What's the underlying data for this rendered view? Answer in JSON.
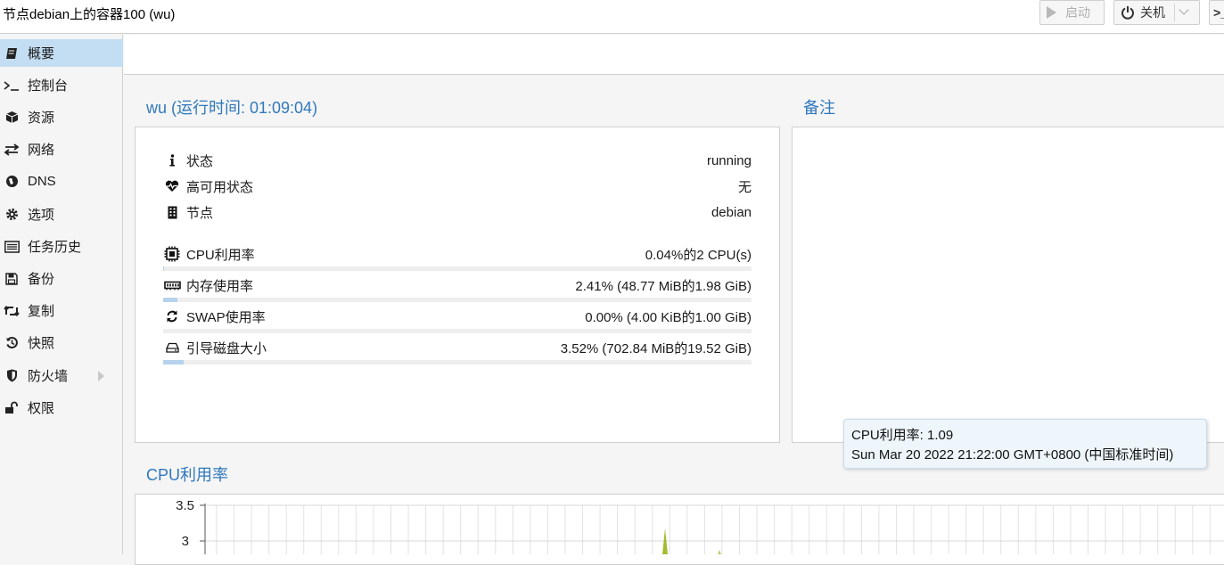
{
  "window": {
    "title": "节点debian上的容器100 (wu)",
    "buttons": {
      "start": "启动",
      "shutdown": "关机",
      "console": ">_"
    }
  },
  "sidebar": {
    "items": [
      {
        "label": "概要",
        "icon": "book-icon",
        "active": true
      },
      {
        "label": "控制台",
        "icon": "terminal-icon"
      },
      {
        "label": "资源",
        "icon": "cube-icon"
      },
      {
        "label": "网络",
        "icon": "exchange-icon"
      },
      {
        "label": "DNS",
        "icon": "globe-icon"
      },
      {
        "label": "选项",
        "icon": "gear-icon"
      },
      {
        "label": "任务历史",
        "icon": "list-icon"
      },
      {
        "label": "备份",
        "icon": "floppy-icon"
      },
      {
        "label": "复制",
        "icon": "retweet-icon"
      },
      {
        "label": "快照",
        "icon": "history-icon"
      },
      {
        "label": "防火墙",
        "icon": "shield-icon",
        "has_submenu": true
      },
      {
        "label": "权限",
        "icon": "unlock-icon"
      }
    ]
  },
  "status_panel": {
    "title": "wu (运行时间: 01:09:04)",
    "rows": [
      {
        "label": "状态",
        "value": "running",
        "icon": "info-icon"
      },
      {
        "label": "高可用状态",
        "value": "无",
        "icon": "heartbeat-icon"
      },
      {
        "label": "节点",
        "value": "debian",
        "icon": "building-icon"
      }
    ],
    "usage": [
      {
        "label": "CPU利用率",
        "value": "0.04%的2 CPU(s)",
        "icon": "cpu-icon",
        "fraction": 0.0004
      },
      {
        "label": "内存使用率",
        "value": "2.41% (48.77 MiB的1.98 GiB)",
        "icon": "memory-icon",
        "fraction": 0.0241
      },
      {
        "label": "SWAP使用率",
        "value": "0.00% (4.00 KiB的1.00 GiB)",
        "icon": "refresh-icon",
        "fraction": 0.0
      },
      {
        "label": "引导磁盘大小",
        "value": "3.52% (702.84 MiB的19.52 GiB)",
        "icon": "hdd-icon",
        "fraction": 0.0352
      }
    ]
  },
  "notes_panel": {
    "title": "备注"
  },
  "cpu_panel": {
    "title": "CPU利用率"
  },
  "tooltip": {
    "line1": "CPU利用率: 1.09",
    "line2": "Sun Mar 20 2022 21:22:00 GMT+0800 (中国标准时间)"
  },
  "chart_data": {
    "type": "area",
    "title": "CPU利用率",
    "y_tick_labels": [
      "3.5",
      "3"
    ],
    "ylim": [
      2.5,
      3.5
    ],
    "grid": true,
    "series_color": "#94ae0a"
  }
}
